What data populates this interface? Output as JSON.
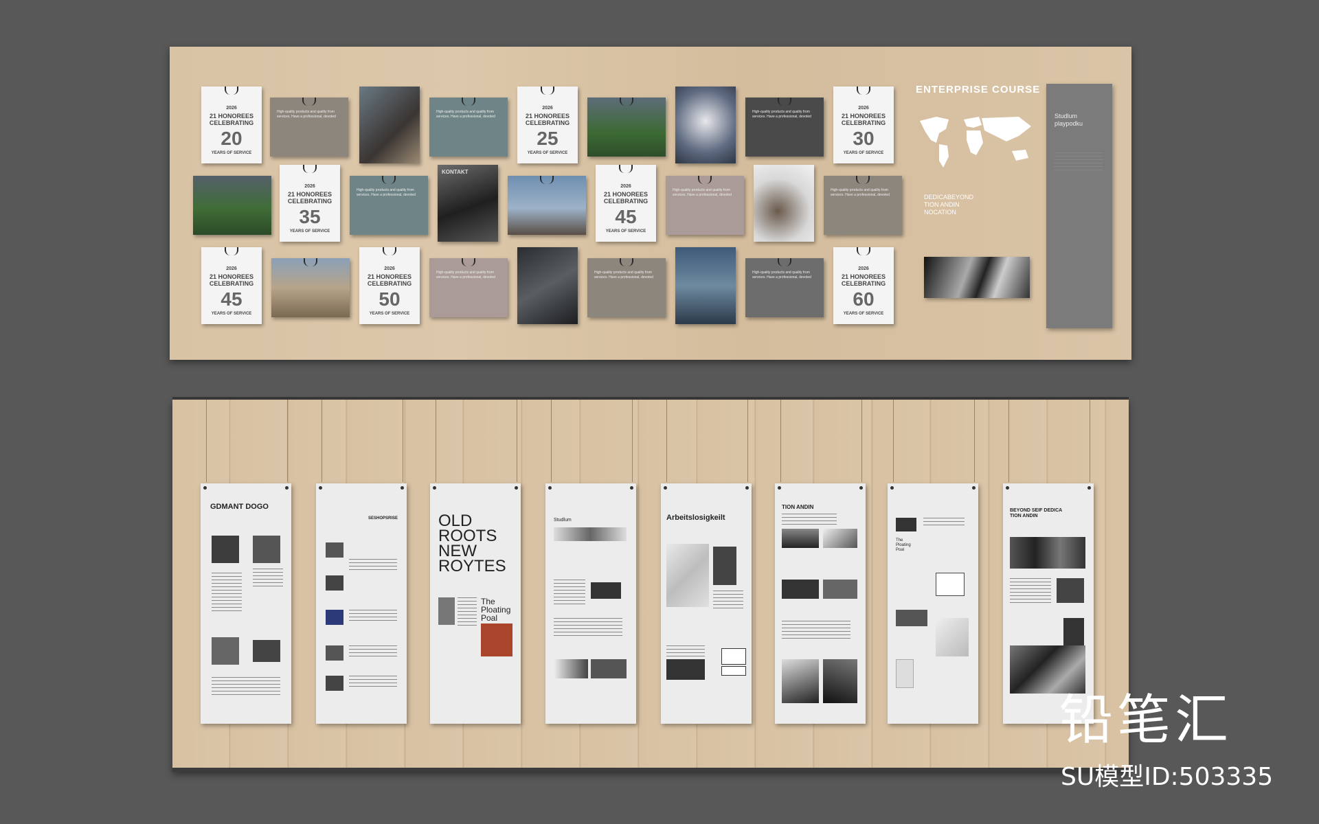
{
  "top_board": {
    "calendars": [
      {
        "year": "2026",
        "line1": "21 HONOREES",
        "line2": "CELEBRATING",
        "number": "20",
        "footer": "YEARS OF SERVICE"
      },
      {
        "year": "2026",
        "line1": "21 HONOREES",
        "line2": "CELEBRATING",
        "number": "25",
        "footer": "YEARS OF SERVICE"
      },
      {
        "year": "2026",
        "line1": "21 HONOREES",
        "line2": "CELEBRATING",
        "number": "30",
        "footer": "YEARS OF SERVICE"
      },
      {
        "year": "2026",
        "line1": "21 HONOREES",
        "line2": "CELEBRATING",
        "number": "35",
        "footer": "YEARS OF SERVICE"
      },
      {
        "year": "2026",
        "line1": "21 HONOREES",
        "line2": "CELEBRATING",
        "number": "45",
        "footer": "YEARS OF SERVICE"
      },
      {
        "year": "2026",
        "line1": "21 HONOREES",
        "line2": "CELEBRATING",
        "number": "45",
        "footer": "YEARS OF SERVICE"
      },
      {
        "year": "2026",
        "line1": "21 HONOREES",
        "line2": "CELEBRATING",
        "number": "50",
        "footer": "YEARS OF SERVICE"
      },
      {
        "year": "2026",
        "line1": "21 HONOREES",
        "line2": "CELEBRATING",
        "number": "60",
        "footer": "YEARS OF SERVICE"
      }
    ],
    "enterprise_title": "ENTERPRISE COURSE",
    "dedica": "DEDICABEYOND\nTION ANDIN\nNOCATION",
    "side_panel": "Studlum\nplaypodku",
    "kontakt": "KONTAKT",
    "card_text": "High-quality products and quality from services. Have a professional, devoted"
  },
  "bottom_board": {
    "sheet1_title": "GDMANT DOGO",
    "sheet2_title": "SESHOPSRISE",
    "sheet3_title": "OLD\nROOTS\nNEW\nROYTES",
    "sheet3_sub": "The\nPloating\nPoal",
    "sheet4_title": "Studlum",
    "sheet5_title": "Arbeitslosigkeilt",
    "sheet6_title": "TION ANDIN",
    "sheet7_title": "The\nPloating\nPoal",
    "sheet8_title": "BEYOND SEIF DEDICA\nTION ANDIN"
  },
  "watermark": {
    "brand": "铅笔汇",
    "model_id": "SU模型ID:503335"
  },
  "colors": {
    "wall": "#585858",
    "wood": "#d9c3a5",
    "card_gray": "#8d867c",
    "card_blue": "#6f8486",
    "card_dark": "#4a4a4a",
    "card_mauve": "#aa9b98"
  }
}
